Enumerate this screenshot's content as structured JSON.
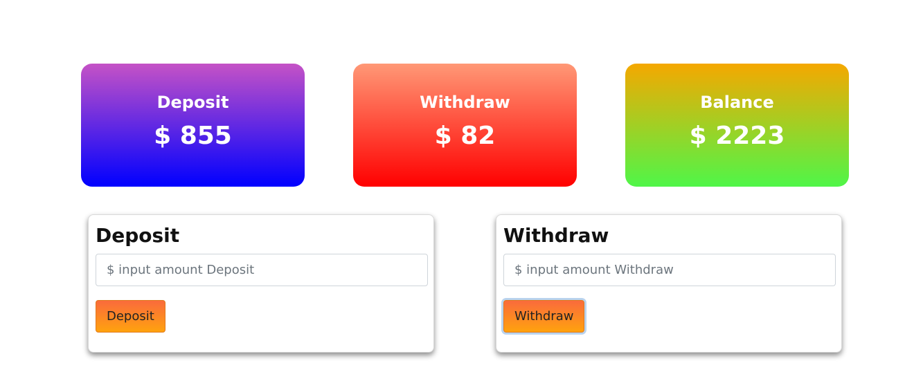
{
  "summary": {
    "deposit": {
      "label": "Deposit",
      "value": "$ 855"
    },
    "withdraw": {
      "label": "Withdraw",
      "value": "$ 82"
    },
    "balance": {
      "label": "Balance",
      "value": "$ 2223"
    }
  },
  "deposit_form": {
    "title": "Deposit",
    "placeholder": "$ input amount Deposit",
    "button_label": "Deposit"
  },
  "withdraw_form": {
    "title": "Withdraw",
    "placeholder": "$ input amount Withdraw",
    "button_label": "Withdraw"
  },
  "colors": {
    "deposit_gradient": [
      "#c552c6",
      "#0000ff"
    ],
    "withdraw_gradient": [
      "#ff9876",
      "#ff0000"
    ],
    "balance_gradient": [
      "#f5a800",
      "#4ff648"
    ],
    "button_gradient": [
      "#fa6b3c",
      "#ffa20e"
    ]
  }
}
